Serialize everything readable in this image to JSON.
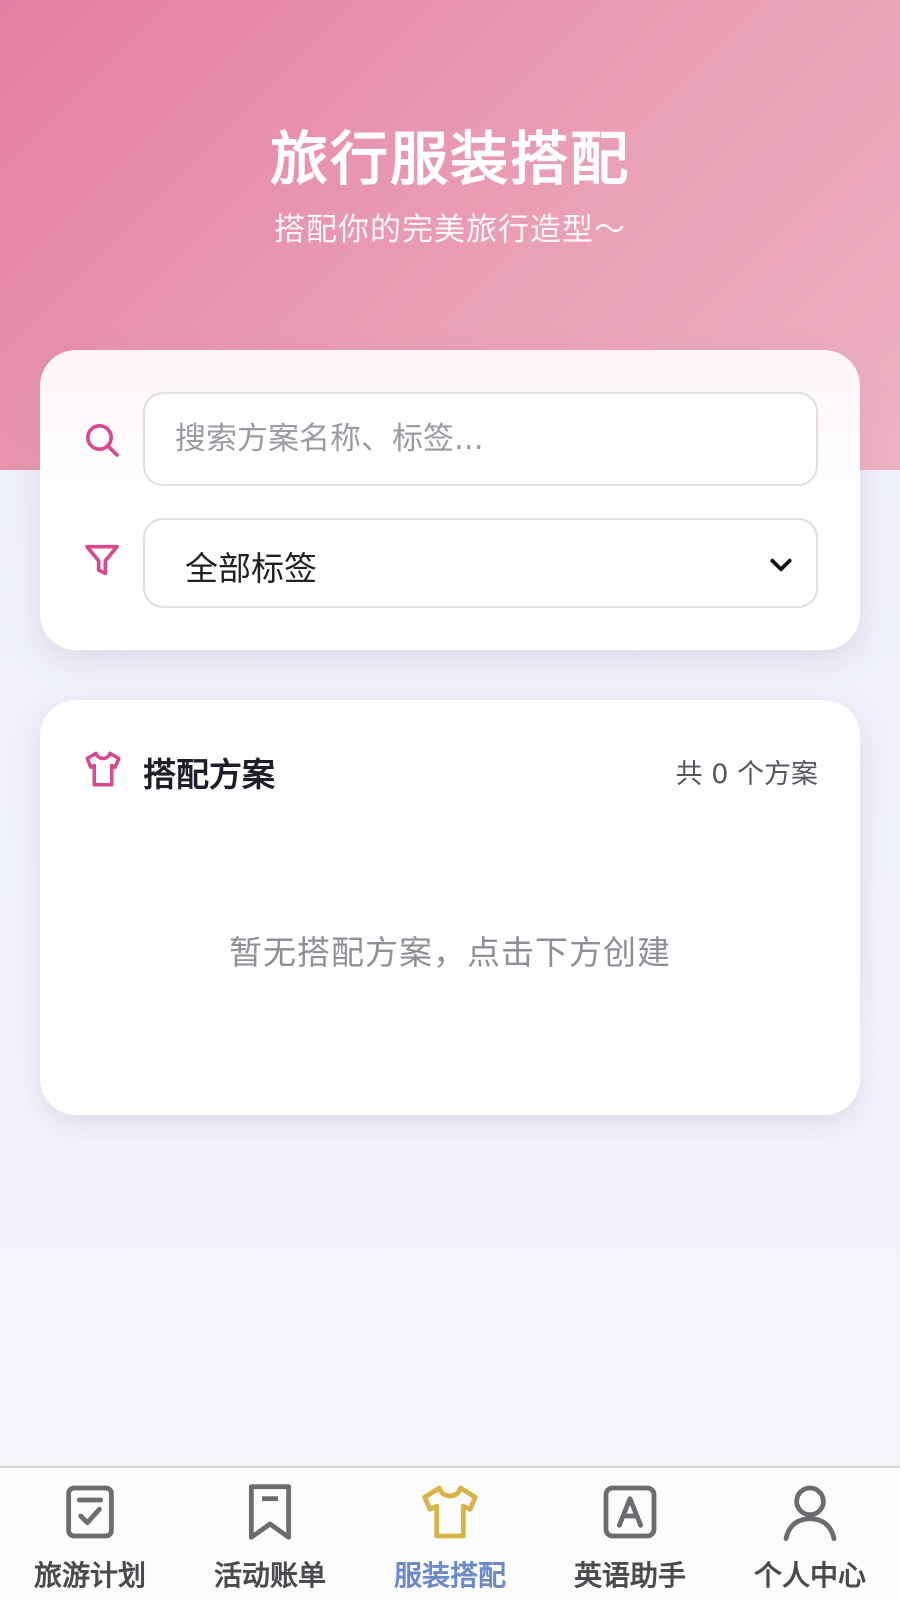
{
  "header": {
    "title": "旅行服装搭配",
    "subtitle": "搭配你的完美旅行造型～"
  },
  "filters": {
    "search_placeholder": "搜索方案名称、标签...",
    "search_value": "",
    "search_icon": "search-icon",
    "tag_icon": "funnel-icon",
    "tag_selected": "全部标签"
  },
  "plans": {
    "icon": "shirt-icon",
    "title": "搭配方案",
    "count_text": "共 0 个方案",
    "empty_text": "暂无搭配方案，点击下方创建"
  },
  "tabbar": {
    "items": [
      {
        "label": "旅游计划",
        "icon": "checklist-icon",
        "active": false
      },
      {
        "label": "活动账单",
        "icon": "bookmark-icon",
        "active": false
      },
      {
        "label": "服装搭配",
        "icon": "shirt-icon",
        "active": true
      },
      {
        "label": "英语助手",
        "icon": "letter-a-icon",
        "active": false
      },
      {
        "label": "个人中心",
        "icon": "user-icon",
        "active": false
      }
    ]
  },
  "colors": {
    "header_gradient_start": "#e57ea4",
    "header_gradient_end": "#eeb1c3",
    "accent_pink": "#d9478d",
    "active_tab_label": "#6c8ac9",
    "active_tab_icon": "#d8b447"
  }
}
